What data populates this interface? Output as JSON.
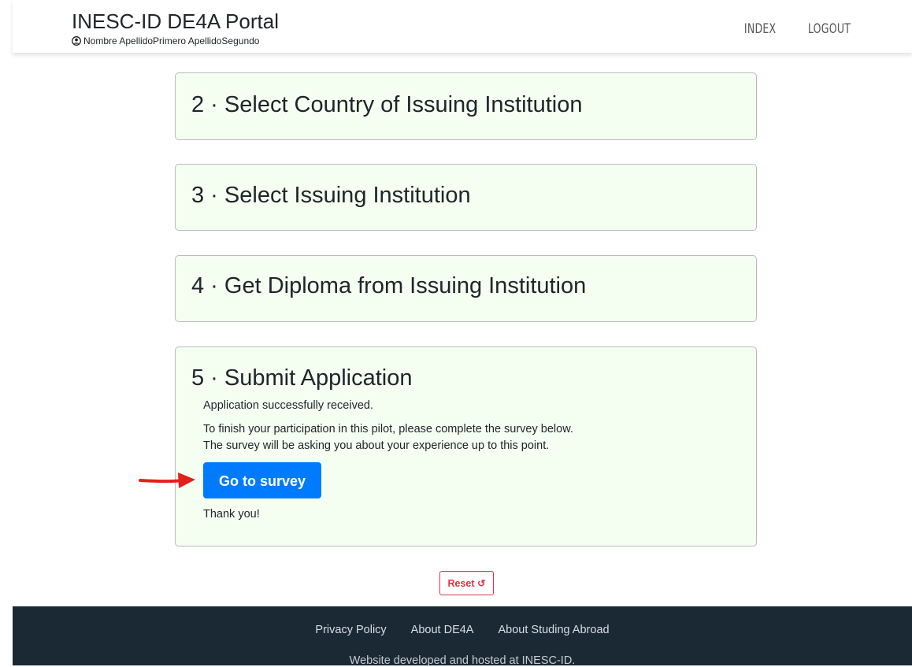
{
  "header": {
    "title": "INESC-ID DE4A Portal",
    "user_name": "Nombre ApellidoPrimero ApellidoSegundo",
    "nav": [
      {
        "label": "INDEX"
      },
      {
        "label": "LOGOUT"
      }
    ]
  },
  "steps": [
    {
      "title": "2 · Select Country of Issuing Institution"
    },
    {
      "title": "3 · Select Issuing Institution"
    },
    {
      "title": "4 · Get Diploma from Issuing Institution"
    },
    {
      "title": "5 · Submit Application",
      "received": "Application successfully received.",
      "instruction_1": "To finish your participation in this pilot, please complete the survey below.",
      "instruction_2": "The survey will be asking you about your experience up to this point.",
      "survey_button": "Go to survey",
      "thanks": "Thank you!"
    }
  ],
  "reset_label": "Reset ↺",
  "footer": {
    "links": [
      "Privacy Policy",
      "About DE4A",
      "About Studing Abroad"
    ],
    "note": "Website developed and hosted at INESC-ID."
  },
  "colors": {
    "card_bg": "#f4fff2",
    "primary": "#007bff",
    "danger": "#dc3545",
    "footer_bg": "#1b2935",
    "annotation_arrow": "#e3201b"
  },
  "icons": {
    "user": "user-circle-icon",
    "annotation": "red-arrow-icon"
  }
}
